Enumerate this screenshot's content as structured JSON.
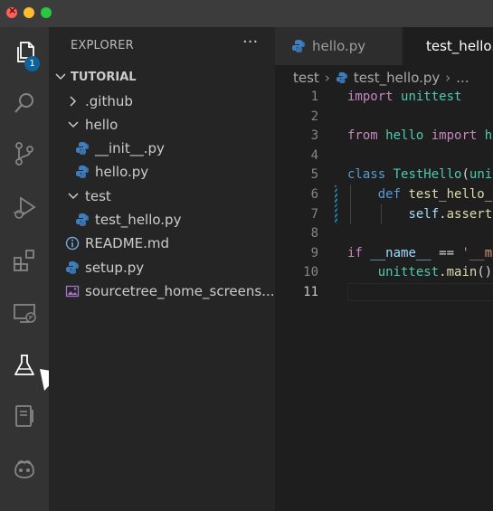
{
  "window": {
    "controls": [
      "close",
      "minimize",
      "maximize"
    ]
  },
  "activity_bar": {
    "items": [
      {
        "name": "explorer",
        "icon": "files-icon",
        "badge": "1"
      },
      {
        "name": "search",
        "icon": "search-icon"
      },
      {
        "name": "source-control",
        "icon": "source-control-icon"
      },
      {
        "name": "run-debug",
        "icon": "run-debug-icon"
      },
      {
        "name": "extensions",
        "icon": "extensions-icon"
      },
      {
        "name": "remote-explorer",
        "icon": "remote-explorer-icon"
      },
      {
        "name": "testing",
        "icon": "flask-icon"
      },
      {
        "name": "notebook",
        "icon": "notebook-icon"
      },
      {
        "name": "copilot",
        "icon": "copilot-icon"
      }
    ]
  },
  "sidebar": {
    "title": "EXPLORER",
    "more": "···",
    "root": "TUTORIAL",
    "items": [
      {
        "label": ".github",
        "type": "folder",
        "expanded": false,
        "depth": 1
      },
      {
        "label": "hello",
        "type": "folder",
        "expanded": true,
        "depth": 1
      },
      {
        "label": "__init__.py",
        "type": "python",
        "depth": 2
      },
      {
        "label": "hello.py",
        "type": "python",
        "depth": 2
      },
      {
        "label": "test",
        "type": "folder",
        "expanded": true,
        "depth": 1
      },
      {
        "label": "test_hello.py",
        "type": "python",
        "depth": 2
      },
      {
        "label": "README.md",
        "type": "info",
        "depth": 1
      },
      {
        "label": "setup.py",
        "type": "python",
        "depth": 1
      },
      {
        "label": "sourcetree_home_screens...",
        "type": "image",
        "depth": 1
      }
    ]
  },
  "tabs": [
    {
      "label": "hello.py",
      "active": false
    },
    {
      "label": "test_hello.py",
      "active": true
    }
  ],
  "breadcrumb": {
    "folder": "test",
    "file": "test_hello.py",
    "more": "..."
  },
  "editor": {
    "current_line": 11,
    "lines": [
      {
        "n": "1",
        "tokens": [
          [
            "kw",
            "import"
          ],
          [
            "plain",
            " "
          ],
          [
            "mod",
            "unittest"
          ]
        ]
      },
      {
        "n": "2",
        "tokens": []
      },
      {
        "n": "3",
        "tokens": [
          [
            "kw",
            "from"
          ],
          [
            "plain",
            " "
          ],
          [
            "mod",
            "hello"
          ],
          [
            "plain",
            " "
          ],
          [
            "kw",
            "import"
          ],
          [
            "plain",
            " "
          ],
          [
            "mod",
            "h"
          ]
        ]
      },
      {
        "n": "4",
        "tokens": []
      },
      {
        "n": "5",
        "tokens": [
          [
            "kw2",
            "class"
          ],
          [
            "plain",
            " "
          ],
          [
            "cls",
            "TestHello"
          ],
          [
            "plain",
            "("
          ],
          [
            "mod",
            "uni"
          ]
        ]
      },
      {
        "n": "6",
        "tokens": [
          [
            "plain",
            "    "
          ],
          [
            "kw2",
            "def"
          ],
          [
            "plain",
            " "
          ],
          [
            "fn",
            "test_hello_"
          ]
        ],
        "modified": true
      },
      {
        "n": "7",
        "tokens": [
          [
            "plain",
            "        "
          ],
          [
            "var",
            "self"
          ],
          [
            "plain",
            "."
          ],
          [
            "fn",
            "assert"
          ]
        ],
        "modified": true
      },
      {
        "n": "8",
        "tokens": []
      },
      {
        "n": "9",
        "tokens": [
          [
            "kw",
            "if"
          ],
          [
            "plain",
            " "
          ],
          [
            "var",
            "__name__"
          ],
          [
            "plain",
            " == "
          ],
          [
            "str",
            "'__m"
          ]
        ]
      },
      {
        "n": "10",
        "tokens": [
          [
            "plain",
            "    "
          ],
          [
            "mod",
            "unittest"
          ],
          [
            "plain",
            "."
          ],
          [
            "fn",
            "main"
          ],
          [
            "plain",
            "()"
          ]
        ]
      },
      {
        "n": "11",
        "tokens": []
      }
    ]
  },
  "colors": {
    "accent_badge": "#0e639c",
    "python_icon": "#3d7fc0",
    "activity_bar": "#333333",
    "sidebar": "#252526",
    "editor": "#1e1e1e"
  }
}
